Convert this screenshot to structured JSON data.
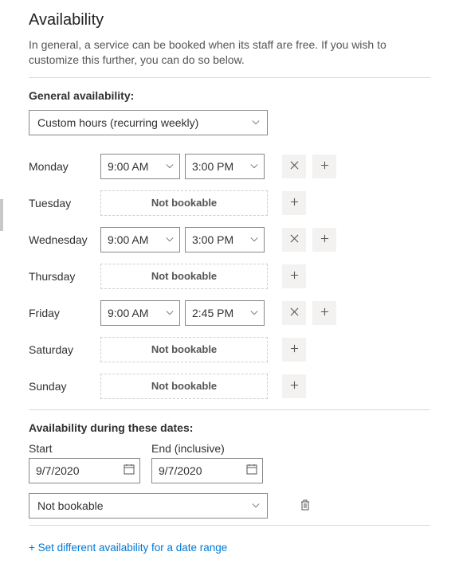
{
  "title": "Availability",
  "description": "In general, a service can be booked when its staff are free. If you wish to customize this further, you can do so below.",
  "general": {
    "heading": "General availability:",
    "mode_selected": "Custom hours (recurring weekly)",
    "not_bookable_label": "Not bookable",
    "days": {
      "monday": {
        "label": "Monday",
        "bookable": true,
        "start": "9:00 AM",
        "end": "3:00 PM"
      },
      "tuesday": {
        "label": "Tuesday",
        "bookable": false
      },
      "wednesday": {
        "label": "Wednesday",
        "bookable": true,
        "start": "9:00 AM",
        "end": "3:00 PM"
      },
      "thursday": {
        "label": "Thursday",
        "bookable": false
      },
      "friday": {
        "label": "Friday",
        "bookable": true,
        "start": "9:00 AM",
        "end": "2:45 PM"
      },
      "saturday": {
        "label": "Saturday",
        "bookable": false
      },
      "sunday": {
        "label": "Sunday",
        "bookable": false
      }
    }
  },
  "dates": {
    "heading": "Availability during these dates:",
    "start_label": "Start",
    "end_label": "End (inclusive)",
    "start_value": "9/7/2020",
    "end_value": "9/7/2020",
    "mode_selected": "Not bookable"
  },
  "link": {
    "prefix": "+ ",
    "text": "Set different availability for a date range"
  }
}
